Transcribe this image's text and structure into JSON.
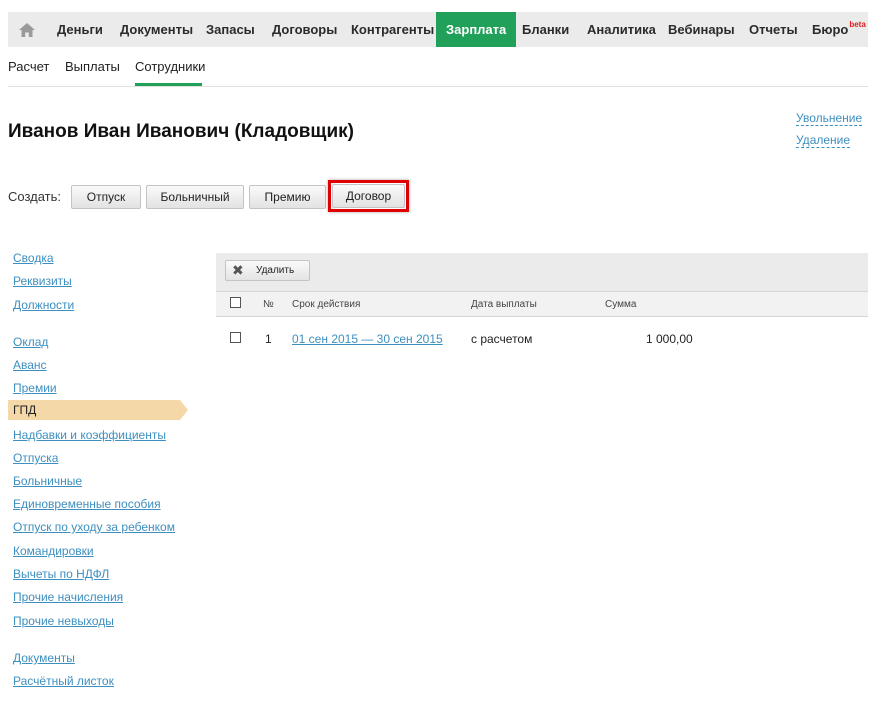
{
  "nav": {
    "home_icon": "home-icon",
    "items": [
      "Деньги",
      "Документы",
      "Запасы",
      "Договоры",
      "Контрагенты",
      "Зарплата",
      "Бланки",
      "Аналитика",
      "Вебинары",
      "Отчеты",
      "Бюро"
    ],
    "active": "Зарплата",
    "beta_badge": "beta"
  },
  "subnav": {
    "items": [
      "Расчет",
      "Выплаты",
      "Сотрудники"
    ],
    "active": "Сотрудники"
  },
  "actions": {
    "dismissal": "Увольнение",
    "delete": "Удаление"
  },
  "employee": {
    "title": "Иванов Иван Иванович (Кладовщик)"
  },
  "create": {
    "label": "Создать:",
    "buttons": [
      "Отпуск",
      "Больничный",
      "Премию",
      "Договор"
    ],
    "highlighted": "Договор"
  },
  "sidebar": {
    "group1": [
      "Сводка",
      "Реквизиты",
      "Должности"
    ],
    "group2": [
      "Оклад",
      "Аванс",
      "Премии",
      "ГПД",
      "Надбавки и коэффициенты",
      "Отпуска",
      "Больничные",
      "Единовременные пособия",
      "Отпуск по уходу за ребенком",
      "Командировки",
      "Вычеты по НДФЛ",
      "Прочие начисления",
      "Прочие невыходы"
    ],
    "group3": [
      "Документы",
      "Расчётный листок"
    ],
    "active": "ГПД"
  },
  "table": {
    "delete_button": "Удалить",
    "delete_icon": "close-icon",
    "columns": [
      "№",
      "Срок действия",
      "Дата выплаты",
      "Сумма"
    ],
    "rows": [
      {
        "num": "1",
        "period": "01 сен 2015 — 30 сен 2015",
        "payment_date": "с расчетом",
        "amount": "1 000,00"
      }
    ]
  },
  "colors": {
    "accent": "#21a05a",
    "link": "#3d8fc0",
    "highlight": "#e00000",
    "sidebar_active": "#f5d8a8"
  }
}
